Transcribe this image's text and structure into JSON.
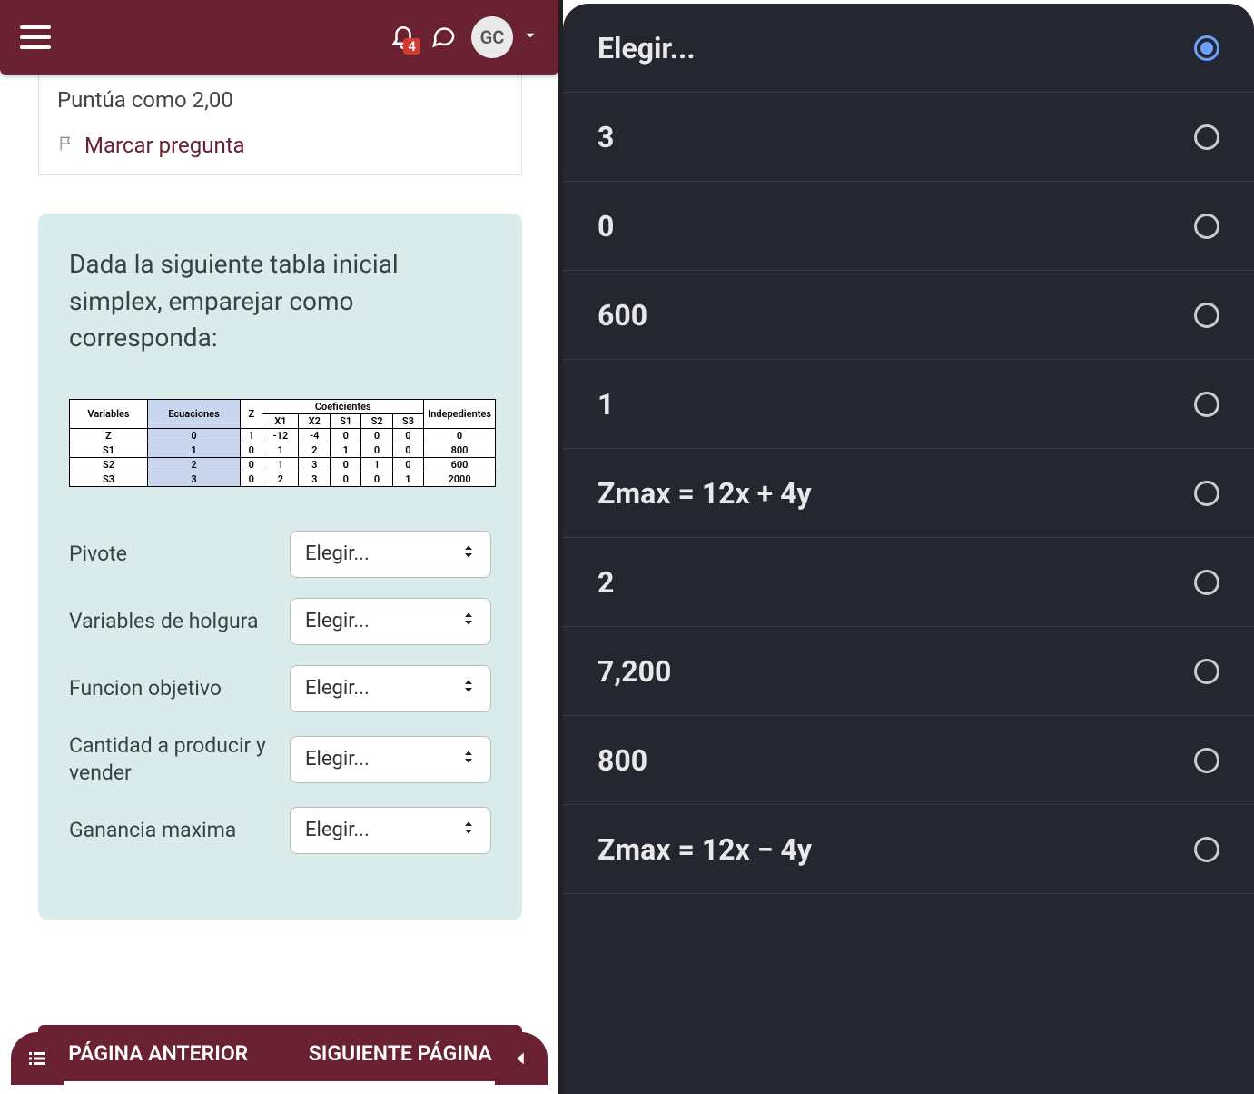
{
  "header": {
    "notification_count": "4",
    "avatar_initials": "GC"
  },
  "info": {
    "score_text": "Puntúa como 2,00",
    "flag_text": "Marcar pregunta"
  },
  "question": {
    "prompt": "Dada la siguiente tabla inicial simplex, emparejar como corresponda:"
  },
  "simplex": {
    "header_variables": "Variables",
    "header_ecuaciones": "Ecuaciones",
    "header_z": "Z",
    "header_coef": "Coeficientes",
    "header_x1": "X1",
    "header_x2": "X2",
    "header_s1": "S1",
    "header_s2": "S2",
    "header_s3": "S3",
    "header_indep": "Indepedientes",
    "rows": [
      {
        "v": "Z",
        "e": "0",
        "z": "1",
        "x1": "-12",
        "x2": "-4",
        "s1": "0",
        "s2": "0",
        "s3": "0",
        "ind": "0"
      },
      {
        "v": "S1",
        "e": "1",
        "z": "0",
        "x1": "1",
        "x2": "2",
        "s1": "1",
        "s2": "0",
        "s3": "0",
        "ind": "800"
      },
      {
        "v": "S2",
        "e": "2",
        "z": "0",
        "x1": "1",
        "x2": "3",
        "s1": "0",
        "s2": "1",
        "s3": "0",
        "ind": "600"
      },
      {
        "v": "S3",
        "e": "3",
        "z": "0",
        "x1": "2",
        "x2": "3",
        "s1": "0",
        "s2": "0",
        "s3": "1",
        "ind": "2000"
      }
    ]
  },
  "matches": [
    {
      "label": "Pivote",
      "placeholder": "Elegir..."
    },
    {
      "label": "Variables de holgura",
      "placeholder": "Elegir..."
    },
    {
      "label": "Funcion objetivo",
      "placeholder": "Elegir..."
    },
    {
      "label": "Cantidad a producir y vender",
      "placeholder": "Elegir..."
    },
    {
      "label": "Ganancia maxima",
      "placeholder": "Elegir..."
    }
  ],
  "nav": {
    "prev": "PÁGINA ANTERIOR",
    "next": "SIGUIENTE PÁGINA"
  },
  "picker": {
    "options": [
      {
        "label": "Elegir...",
        "selected": true
      },
      {
        "label": "3",
        "selected": false
      },
      {
        "label": "0",
        "selected": false
      },
      {
        "label": "600",
        "selected": false
      },
      {
        "label": "1",
        "selected": false
      },
      {
        "label": "Zmax = 12x + 4y",
        "selected": false
      },
      {
        "label": "2",
        "selected": false
      },
      {
        "label": "7,200",
        "selected": false
      },
      {
        "label": "800",
        "selected": false
      },
      {
        "label": "Zmax = 12x − 4y",
        "selected": false
      }
    ]
  }
}
